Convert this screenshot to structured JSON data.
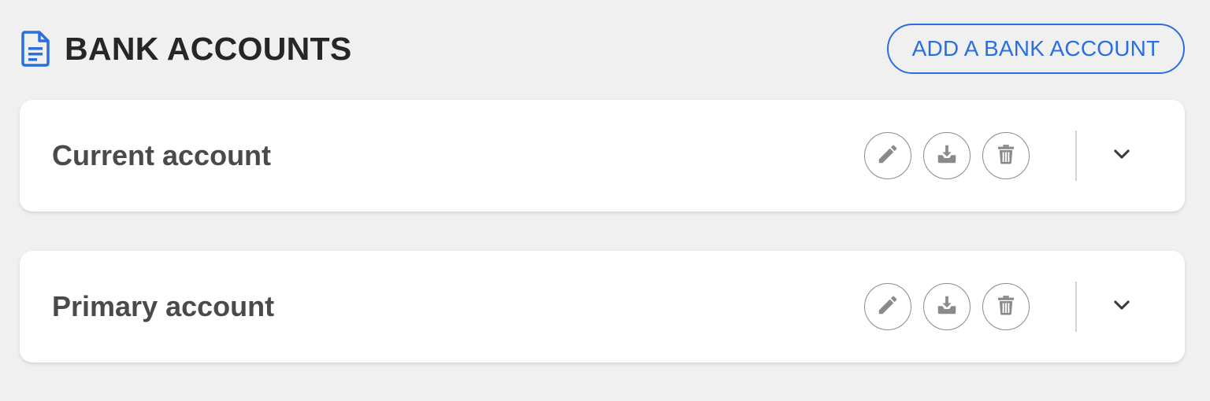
{
  "header": {
    "title": "BANK ACCOUNTS",
    "add_button_label": "ADD A BANK ACCOUNT"
  },
  "accounts": [
    {
      "name": "Current account"
    },
    {
      "name": "Primary account"
    }
  ],
  "icons": {
    "title": "document-icon",
    "edit": "pencil-icon",
    "download": "download-tray-icon",
    "delete": "trash-icon",
    "expand": "chevron-down-icon"
  },
  "colors": {
    "accent": "#2a6fe0",
    "background": "#f0f0f0",
    "card": "#ffffff",
    "title_text": "#262626",
    "account_text": "#4a4a4a",
    "icon_gray": "#8a8a8a"
  }
}
